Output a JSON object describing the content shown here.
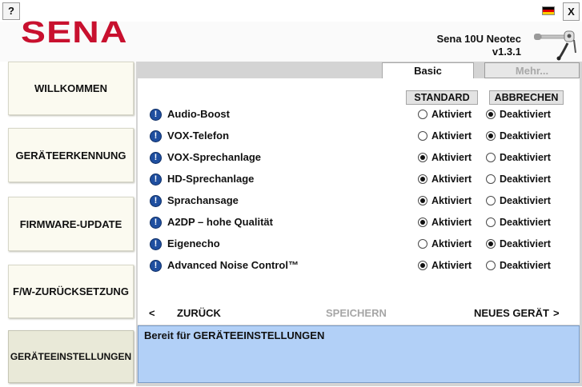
{
  "window": {
    "help_label": "?",
    "close_label": "X",
    "language_flag_colors": [
      "#000000",
      "#dd0000",
      "#ffce00"
    ]
  },
  "header": {
    "logo_text": "SENA",
    "brand_color": "#c8102e",
    "device_name": "Sena 10U Neotec",
    "device_version": "v1.3.1",
    "device_icon": "headset-icon"
  },
  "nav": {
    "items": [
      {
        "label": "WILLKOMMEN",
        "active": false
      },
      {
        "label": "GERÄTEERKENNUNG",
        "active": false
      },
      {
        "label": "FIRMWARE-UPDATE",
        "active": false
      },
      {
        "label": "F/W-ZURÜCKSETZUNG",
        "active": false
      },
      {
        "label": "GERÄTEEINSTELLUNGEN",
        "active": true
      }
    ]
  },
  "tabs": [
    {
      "label": "Basic",
      "active": true
    },
    {
      "label": "Mehr...",
      "active": false
    }
  ],
  "actions": {
    "standard_label": "STANDARD",
    "cancel_label": "ABBRECHEN"
  },
  "settings": {
    "option_on_label": "Aktiviert",
    "option_off_label": "Deaktiviert",
    "rows": [
      {
        "label": "Audio-Boost",
        "value": "off"
      },
      {
        "label": "VOX-Telefon",
        "value": "off"
      },
      {
        "label": "VOX-Sprechanlage",
        "value": "on"
      },
      {
        "label": "HD-Sprechanlage",
        "value": "on"
      },
      {
        "label": "Sprachansage",
        "value": "on"
      },
      {
        "label": "A2DP – hohe Qualität",
        "value": "on"
      },
      {
        "label": "Eigenecho",
        "value": "off"
      },
      {
        "label": "Advanced Noise Control™",
        "value": "on"
      }
    ]
  },
  "bottom_nav": {
    "back_arrow": "<",
    "back_label": "ZURÜCK",
    "save_label": "SPEICHERN",
    "next_label": "NEUES GERÄT",
    "next_arrow": ">"
  },
  "status": {
    "text": "Bereit für GERÄTEEINSTELLUNGEN",
    "background": "#b2d0f7"
  }
}
